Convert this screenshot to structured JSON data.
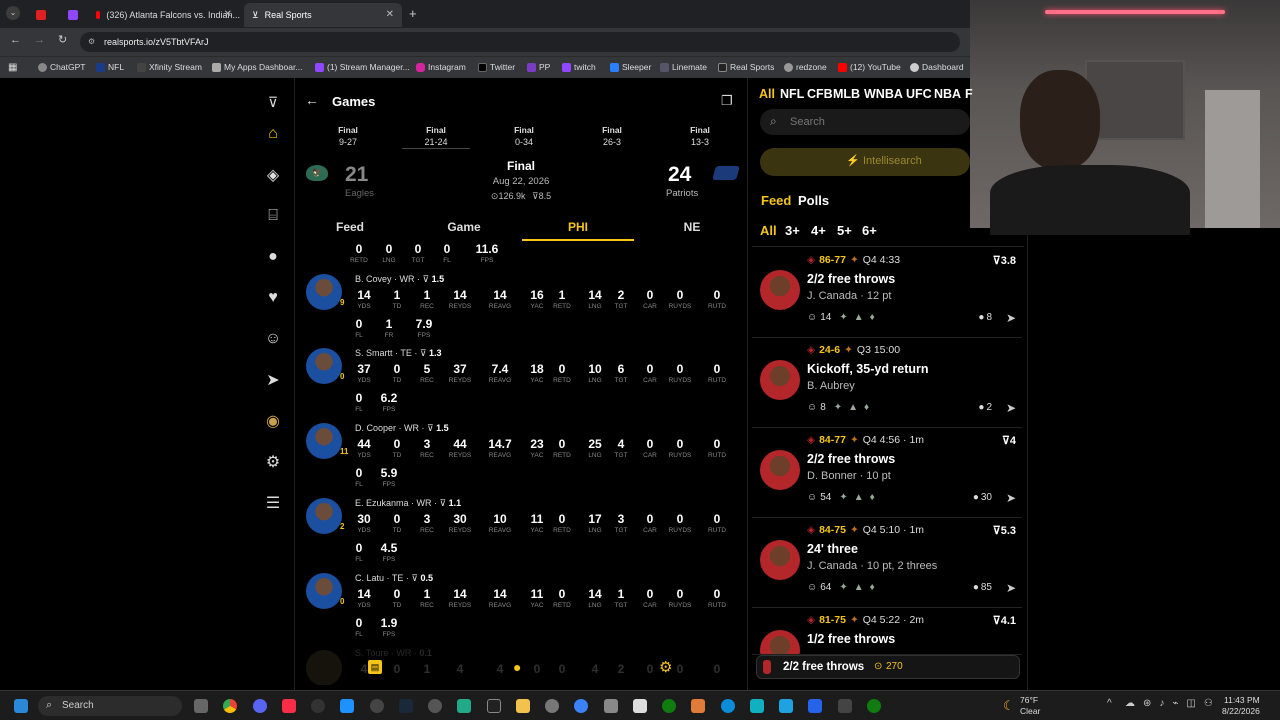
{
  "browser": {
    "tabs": [
      {
        "label": ""
      },
      {
        "label": ""
      },
      {
        "label": "(326) Atlanta Falcons vs. Indian..."
      },
      {
        "label": "Real Sports"
      }
    ],
    "url": "realsports.io/zV5TbtVFArJ",
    "bookmarks": [
      "ChatGPT",
      "NFL",
      "Xfinity Stream",
      "My Apps Dashboar...",
      "(1) Stream Manager...",
      "Instagram",
      "Twitter",
      "PP",
      "twitch",
      "Sleeper",
      "Linemate",
      "Real Sports",
      "redzone",
      "(12) YouTube",
      "Dashboard"
    ]
  },
  "header": {
    "title": "Games"
  },
  "scoreboard": [
    {
      "status": "Final",
      "score": "9-27"
    },
    {
      "status": "Final",
      "score": "21-24"
    },
    {
      "status": "Final",
      "score": "0-34"
    },
    {
      "status": "Final",
      "score": "26-3"
    },
    {
      "status": "Final",
      "score": "13-3"
    }
  ],
  "game": {
    "away_score": "21",
    "away_team": "Eagles",
    "status": "Final",
    "date": "Aug 22, 2026",
    "views": "126.9k",
    "rating": "8.5",
    "home_score": "24",
    "home_team": "Patriots"
  },
  "tabs": [
    "Feed",
    "Game",
    "PHI",
    "NE"
  ],
  "stat_labels": {
    "yds": "YDS",
    "td": "TD",
    "rec": "REC",
    "reyds": "REYDS",
    "reavg": "REAVG",
    "yac": "YAC",
    "retd": "RETD",
    "lng": "LNG",
    "tgt": "TGT",
    "car": "CAR",
    "ruyds": "RUYDS",
    "rutd": "RUTD",
    "fl": "FL",
    "fr": "FR",
    "fps": "FPS"
  },
  "top_row": {
    "v": [
      "0",
      "0",
      "0",
      "0",
      "11.6"
    ],
    "l": [
      "RETD",
      "LNG",
      "TGT",
      "FL",
      "FPS"
    ]
  },
  "players": [
    {
      "name": "B. Covey · WR · ",
      "rating": "1.5",
      "badge": "9",
      "row1": [
        "14",
        "1",
        "1",
        "14",
        "14",
        "16",
        "1",
        "14",
        "2",
        "0",
        "0",
        "0"
      ],
      "row2v": [
        "0",
        "1",
        "7.9"
      ],
      "row2l": [
        "FL",
        "FR",
        "FPS"
      ]
    },
    {
      "name": "S. Smartt · TE · ",
      "rating": "1.3",
      "badge": "0",
      "row1": [
        "37",
        "0",
        "5",
        "37",
        "7.4",
        "18",
        "0",
        "10",
        "6",
        "0",
        "0",
        "0"
      ],
      "row2v": [
        "0",
        "6.2"
      ],
      "row2l": [
        "FL",
        "FPS"
      ]
    },
    {
      "name": "D. Cooper · WR · ",
      "rating": "1.5",
      "badge": "11",
      "row1": [
        "44",
        "0",
        "3",
        "44",
        "14.7",
        "23",
        "0",
        "25",
        "4",
        "0",
        "0",
        "0"
      ],
      "row2v": [
        "0",
        "5.9"
      ],
      "row2l": [
        "FL",
        "FPS"
      ]
    },
    {
      "name": "E. Ezukanma · WR · ",
      "rating": "1.1",
      "badge": "2",
      "row1": [
        "30",
        "0",
        "3",
        "30",
        "10",
        "11",
        "0",
        "17",
        "3",
        "0",
        "0",
        "0"
      ],
      "row2v": [
        "0",
        "4.5"
      ],
      "row2l": [
        "FL",
        "FPS"
      ]
    },
    {
      "name": "C. Latu · TE · ",
      "rating": "0.5",
      "badge": "0",
      "row1": [
        "14",
        "0",
        "1",
        "14",
        "14",
        "11",
        "0",
        "14",
        "1",
        "0",
        "0",
        "0"
      ],
      "row2v": [
        "0",
        "1.9"
      ],
      "row2l": [
        "FL",
        "FPS"
      ]
    }
  ],
  "partial_player": {
    "name": "S. Toure · WR · ",
    "rating": "0.1",
    "row1": [
      "4",
      "0",
      "1",
      "4",
      "4",
      "0",
      "0",
      "4",
      "2",
      "0",
      "0",
      "0"
    ]
  },
  "right": {
    "leagues": [
      "All",
      "NFL",
      "CFB",
      "MLB",
      "WNBA",
      "UFC",
      "NBA",
      "F"
    ],
    "search_placeholder": "Search",
    "intellisearch": "Intellisearch",
    "feed_tabs": [
      "Feed",
      "Polls"
    ],
    "filters": [
      "All",
      "3+",
      "4+",
      "5+",
      "6+"
    ],
    "cards": [
      {
        "score": "86-77",
        "meta": "Q4 4:33",
        "title": "2/2 free throws",
        "sub": "J. Canada",
        "sub2": " · 12 pt",
        "reacts": "14",
        "comments": "8",
        "rating": "3.8"
      },
      {
        "score": "24-6",
        "meta": "Q3 15:00",
        "title": "Kickoff, 35-yd return",
        "sub": "B. Aubrey",
        "sub2": "",
        "reacts": "8",
        "comments": "2",
        "rating": ""
      },
      {
        "score": "84-77",
        "meta": "Q4 4:56 · 1m",
        "title": "2/2 free throws",
        "sub": "D. Bonner",
        "sub2": " · 10 pt",
        "reacts": "54",
        "comments": "30",
        "rating": "4"
      },
      {
        "score": "84-75",
        "meta": "Q4 5:10 · 1m",
        "title": "24' three",
        "sub": "J. Canada",
        "sub2": " · 10 pt, 2 threes",
        "reacts": "64",
        "comments": "85",
        "rating": "5.3"
      },
      {
        "score": "81-75",
        "meta": "Q4 5:22 · 2m",
        "title": "1/2 free throws",
        "sub": "",
        "sub2": "",
        "reacts": "",
        "comments": "",
        "rating": "4.1"
      }
    ],
    "toast": {
      "title": "2/2 free throws",
      "count": "270"
    }
  },
  "taskbar": {
    "search": "Search",
    "weather_temp": "76°F",
    "weather_desc": "Clear",
    "time": "11:43 PM",
    "date": "8/22/2026"
  }
}
